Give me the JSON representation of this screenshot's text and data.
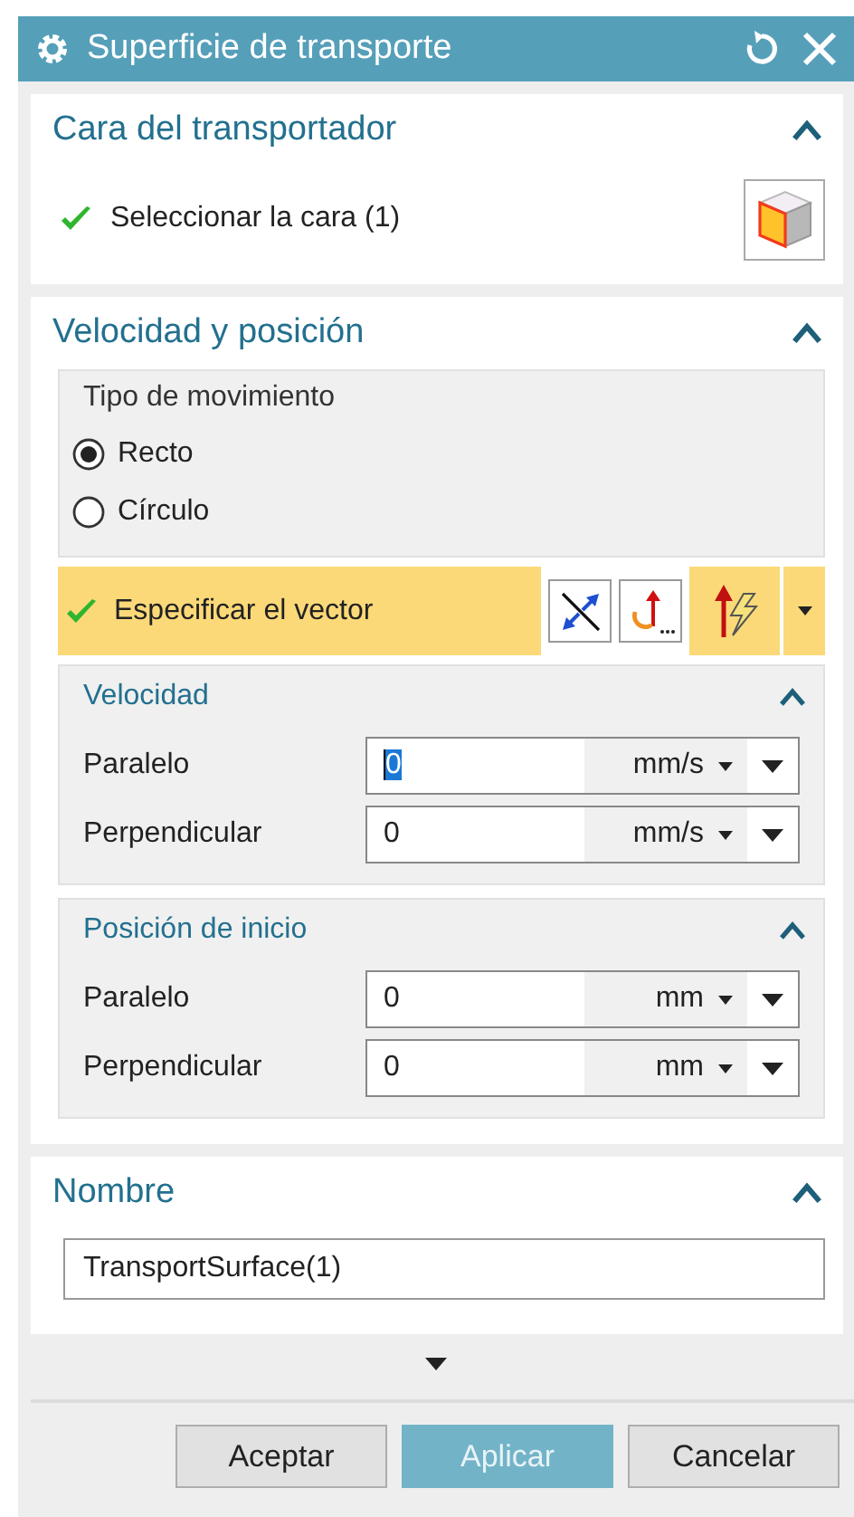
{
  "window": {
    "title": "Superficie de transporte"
  },
  "face_section": {
    "title": "Cara del transportador",
    "expanded": true,
    "selector": {
      "label": "Seleccionar la cara (1)",
      "complete": true
    }
  },
  "motion_section": {
    "title": "Velocidad y posición",
    "expanded": true,
    "motion_type": {
      "title": "Tipo de movimiento",
      "options": [
        {
          "label": "Recto",
          "selected": true
        },
        {
          "label": "Círculo",
          "selected": false
        }
      ]
    },
    "vector": {
      "label": "Especificar el vector",
      "complete": true
    },
    "groups": [
      {
        "title": "Velocidad",
        "expanded": true,
        "fields": [
          {
            "label": "Paralelo",
            "value": "0",
            "unit": "mm/s",
            "focused": true
          },
          {
            "label": "Perpendicular",
            "value": "0",
            "unit": "mm/s",
            "focused": false
          }
        ]
      },
      {
        "title": "Posición de inicio",
        "expanded": true,
        "fields": [
          {
            "label": "Paralelo",
            "value": "0",
            "unit": "mm",
            "focused": false
          },
          {
            "label": "Perpendicular",
            "value": "0",
            "unit": "mm",
            "focused": false
          }
        ]
      }
    ]
  },
  "name_section": {
    "title": "Nombre",
    "expanded": true,
    "value": "TransportSurface(1)"
  },
  "buttons": [
    {
      "label": "Aceptar",
      "default": false
    },
    {
      "label": "Aplicar",
      "default": true
    },
    {
      "label": "Cancelar",
      "default": false
    }
  ]
}
